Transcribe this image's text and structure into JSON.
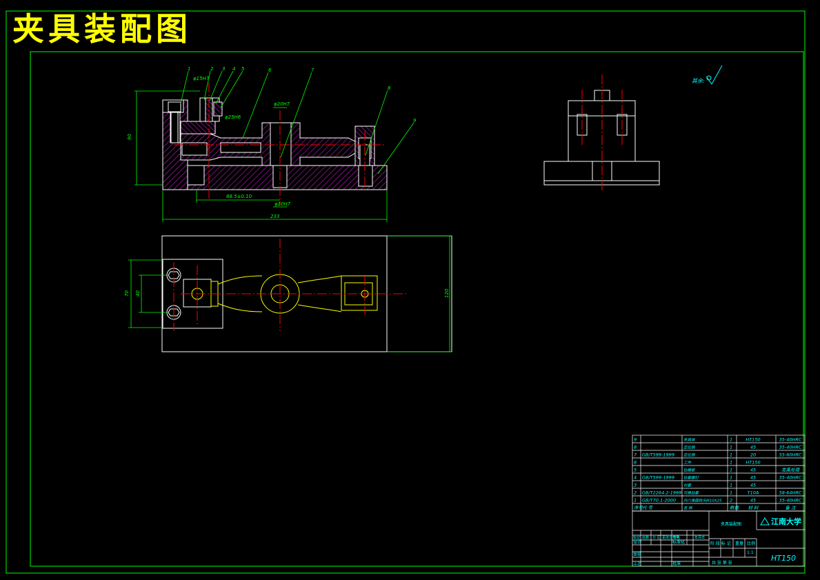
{
  "title": "夹具装配图",
  "roughness_note": "其余:",
  "dims": {
    "height_90": "90",
    "length_233": "233",
    "center_dist": "88.5±0.10",
    "width_120": "120",
    "d70": "70",
    "d40": "40",
    "dia1": "φ15H7",
    "dia2": "φ25H6",
    "dia3": "φ20H7",
    "dia4": "φ10H7"
  },
  "leaders": [
    "1",
    "2",
    "3",
    "4",
    "5",
    "6",
    "7",
    "8",
    "9"
  ],
  "bom": [
    {
      "no": "9",
      "std": "",
      "name": "夹具体",
      "qty": "1",
      "mat": "HT150",
      "note": "35-40HRC"
    },
    {
      "no": "8",
      "std": "",
      "name": "定位销",
      "qty": "1",
      "mat": "45",
      "note": "35-40HRC"
    },
    {
      "no": "7",
      "std": "GB/T599-1999",
      "name": "定位销",
      "qty": "1",
      "mat": "20",
      "note": "55-60HRC"
    },
    {
      "no": "6",
      "std": "",
      "name": "工件",
      "qty": "1",
      "mat": "HT150",
      "note": ""
    },
    {
      "no": "5",
      "std": "",
      "name": "钻模板",
      "qty": "1",
      "mat": "45",
      "note": "发黑处理"
    },
    {
      "no": "4",
      "std": "GB/T599-1999",
      "name": "钻套螺钉",
      "qty": "1",
      "mat": "45",
      "note": "35-40HRC"
    },
    {
      "no": "3",
      "std": "",
      "name": "衬套",
      "qty": "1",
      "mat": "45",
      "note": ""
    },
    {
      "no": "2",
      "std": "GB/T2264.2-1999",
      "name": "可换钻套",
      "qty": "1",
      "mat": "T10A",
      "note": "58-64HRC"
    },
    {
      "no": "1",
      "std": "GB/T70.1-2000",
      "name": "内六角圆柱头M10X25",
      "qty": "2",
      "mat": "45",
      "note": "35-40HRC"
    }
  ],
  "bom_header": {
    "no": "序号",
    "std": "代 号",
    "name": "名 称",
    "qty": "数量",
    "mat": "材 料",
    "note": "备 注"
  },
  "title_block": {
    "drawing_name": "夹具装配图",
    "school": "江南大学",
    "material": "HT150",
    "scale_label": "比例",
    "scale": "1:1",
    "stage_label": "阶 段 标 记",
    "weight_label": "重量",
    "sheets": "共 张  第 张",
    "rev_labels": [
      "标记",
      "处数",
      "分 区",
      "更改文件号",
      "签名",
      "年月日"
    ],
    "design": "设计",
    "std": "标准化",
    "review": "审核",
    "craft": "工艺",
    "approve": "批准"
  }
}
